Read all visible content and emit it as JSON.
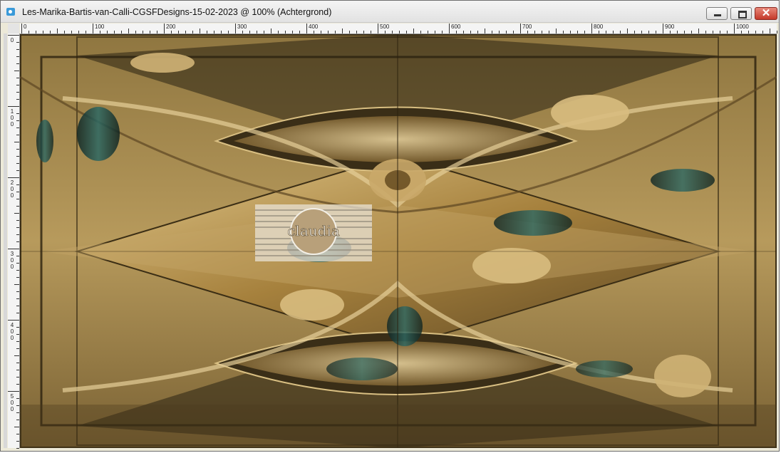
{
  "window": {
    "title": "Les-Marika-Bartis-van-Calli-CGSFDesigns-15-02-2023 @ 100% (Achtergrond)",
    "icon": "app-document-icon",
    "controls": {
      "minimize": "minimize-icon",
      "maximize": "maximize-icon",
      "close": "close-icon"
    }
  },
  "ruler": {
    "top_labels": [
      "0",
      "100",
      "200",
      "300",
      "400",
      "500",
      "600",
      "700",
      "800",
      "900",
      "1000"
    ],
    "left_labels": [
      "0",
      "100",
      "200",
      "300",
      "400",
      "500"
    ]
  },
  "canvas": {
    "watermark_text": "claudia",
    "colors": {
      "gold_light": "#d9bf82",
      "gold": "#a6813d",
      "bronze": "#6b5528",
      "dark": "#1d1810",
      "teal": "#1f4d4a"
    }
  }
}
